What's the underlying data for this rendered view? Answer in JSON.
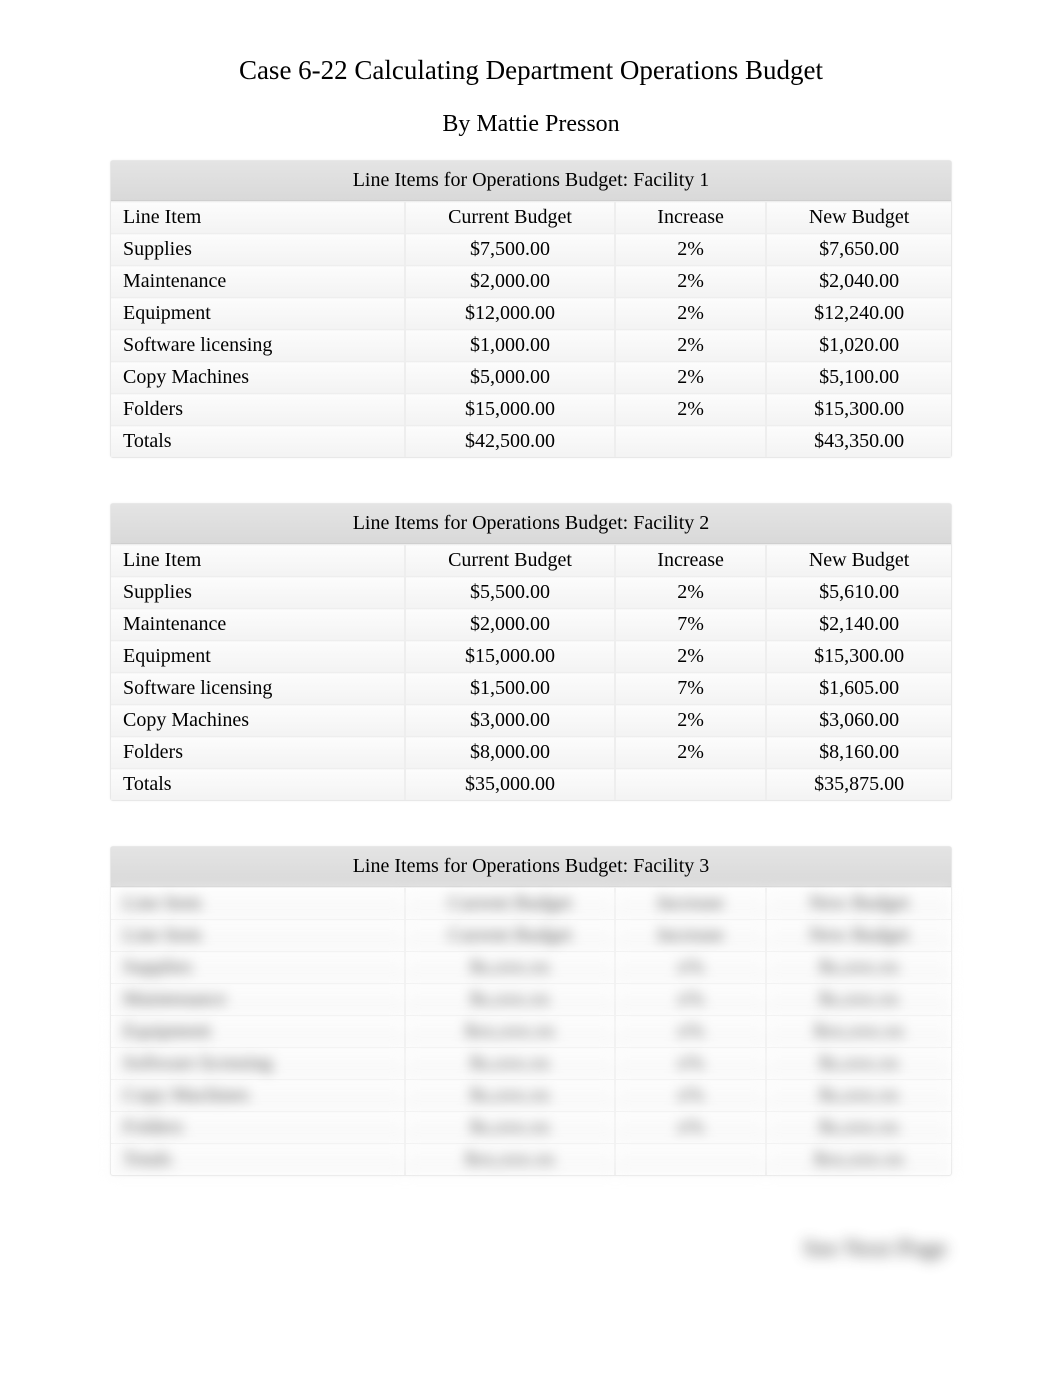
{
  "title": "Case 6-22 Calculating Department Operations Budget",
  "byline": "By Mattie Presson",
  "columns": {
    "name": "Line Item",
    "current": "Current Budget",
    "increase": "Increase",
    "newb": "New Budget"
  },
  "tables": [
    {
      "caption": "Line Items for Operations Budget: Facility 1",
      "rows": [
        {
          "name": "Supplies",
          "current": "$7,500.00",
          "increase": "2%",
          "newb": "$7,650.00"
        },
        {
          "name": "Maintenance",
          "current": "$2,000.00",
          "increase": "2%",
          "newb": "$2,040.00"
        },
        {
          "name": "Equipment",
          "current": "$12,000.00",
          "increase": "2%",
          "newb": "$12,240.00"
        },
        {
          "name": "Software licensing",
          "current": "$1,000.00",
          "increase": "2%",
          "newb": "$1,020.00"
        },
        {
          "name": "Copy Machines",
          "current": "$5,000.00",
          "increase": "2%",
          "newb": "$5,100.00"
        },
        {
          "name": "Folders",
          "current": "$15,000.00",
          "increase": "2%",
          "newb": "$15,300.00"
        }
      ],
      "totals": {
        "name": "Totals",
        "current": "$42,500.00",
        "increase": "",
        "newb": "$43,350.00"
      },
      "blurred": false
    },
    {
      "caption": "Line Items for Operations Budget: Facility 2",
      "rows": [
        {
          "name": "Supplies",
          "current": "$5,500.00",
          "increase": "2%",
          "newb": "$5,610.00"
        },
        {
          "name": "Maintenance",
          "current": "$2,000.00",
          "increase": "7%",
          "newb": "$2,140.00"
        },
        {
          "name": "Equipment",
          "current": "$15,000.00",
          "increase": "2%",
          "newb": "$15,300.00"
        },
        {
          "name": "Software licensing",
          "current": "$1,500.00",
          "increase": "7%",
          "newb": "$1,605.00"
        },
        {
          "name": "Copy Machines",
          "current": "$3,000.00",
          "increase": "2%",
          "newb": "$3,060.00"
        },
        {
          "name": "Folders",
          "current": "$8,000.00",
          "increase": "2%",
          "newb": "$8,160.00"
        }
      ],
      "totals": {
        "name": "Totals",
        "current": "$35,000.00",
        "increase": "",
        "newb": "$35,875.00"
      },
      "blurred": false
    },
    {
      "caption": "Line Items for Operations Budget: Facility 3",
      "rows": [
        {
          "name": "Line Item",
          "current": "Current Budget",
          "increase": "Increase",
          "newb": "New Budget"
        },
        {
          "name": "Supplies",
          "current": "$x,xxx.xx",
          "increase": "x%",
          "newb": "$x,xxx.xx"
        },
        {
          "name": "Maintenance",
          "current": "$x,xxx.xx",
          "increase": "x%",
          "newb": "$x,xxx.xx"
        },
        {
          "name": "Equipment",
          "current": "$xx,xxx.xx",
          "increase": "x%",
          "newb": "$xx,xxx.xx"
        },
        {
          "name": "Software licensing",
          "current": "$x,xxx.xx",
          "increase": "x%",
          "newb": "$x,xxx.xx"
        },
        {
          "name": "Copy Machines",
          "current": "$x,xxx.xx",
          "increase": "x%",
          "newb": "$x,xxx.xx"
        },
        {
          "name": "Folders",
          "current": "$x,xxx.xx",
          "increase": "x%",
          "newb": "$x,xxx.xx"
        }
      ],
      "totals": {
        "name": "Totals",
        "current": "$xx,xxx.xx",
        "increase": "",
        "newb": "$xx,xxx.xx"
      },
      "blurred": true
    }
  ],
  "footer": "See Next Page"
}
